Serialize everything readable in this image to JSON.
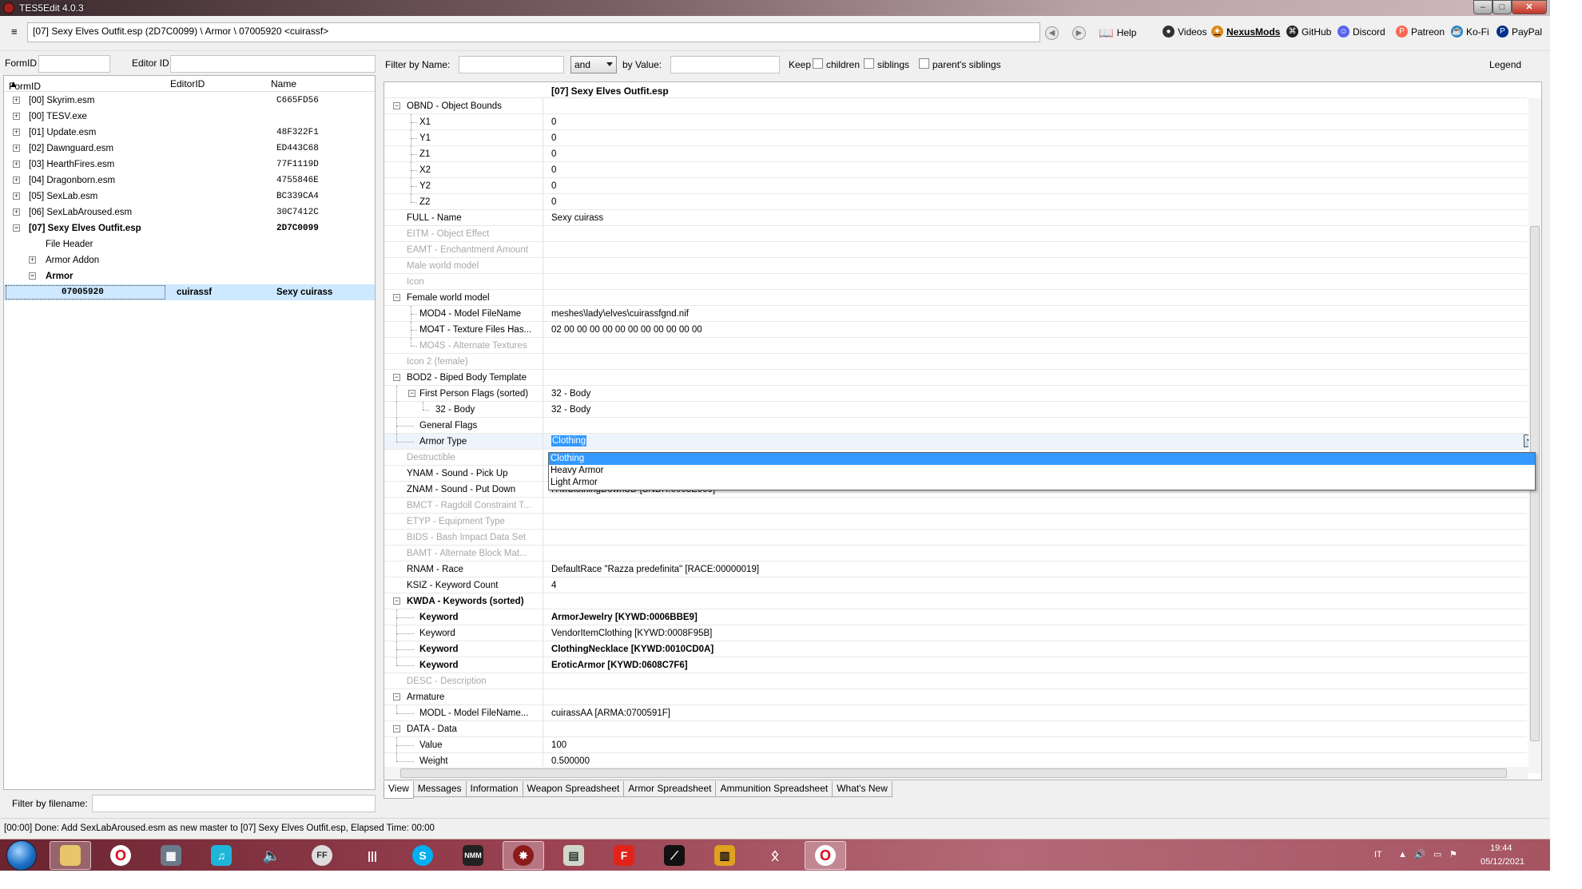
{
  "window": {
    "title": "TES5Edit 4.0.3"
  },
  "toolbar": {
    "path": "[07] Sexy Elves Outfit.esp (2D7C0099) \\ Armor \\ 07005920 <cuirassf>",
    "links": [
      "Help",
      "Videos",
      "NexusMods",
      "GitHub",
      "Discord",
      "Patreon",
      "Ko-Fi",
      "PayPal"
    ]
  },
  "left": {
    "formid_label": "FormID",
    "editorid_label": "Editor ID",
    "columns": [
      "FormID",
      "EditorID",
      "Name"
    ],
    "tree": [
      {
        "label": "[00] Skyrim.esm",
        "name": "C665FD56"
      },
      {
        "label": "[00] TESV.exe",
        "name": ""
      },
      {
        "label": "[01] Update.esm",
        "name": "48F322F1"
      },
      {
        "label": "[02] Dawnguard.esm",
        "name": "ED443C68"
      },
      {
        "label": "[03] HearthFires.esm",
        "name": "77F1119D"
      },
      {
        "label": "[04] Dragonborn.esm",
        "name": "4755846E"
      },
      {
        "label": "[05] SexLab.esm",
        "name": "BC339CA4"
      },
      {
        "label": "[06] SexLabAroused.esm",
        "name": "30C7412C"
      },
      {
        "label": "[07] Sexy Elves Outfit.esp",
        "name": "2D7C0099"
      },
      {
        "label": "File Header",
        "name": ""
      },
      {
        "label": "Armor Addon",
        "name": ""
      },
      {
        "label": "Armor",
        "name": ""
      },
      {
        "label": "07005920",
        "editorid": "cuirassf",
        "name": "Sexy cuirass"
      }
    ],
    "filter_label": "Filter by filename:"
  },
  "filter": {
    "by_name": "Filter by Name:",
    "and": "and",
    "by_value": "by Value:",
    "keep": "Keep",
    "children": "children",
    "siblings": "siblings",
    "parents_siblings": "parent's siblings",
    "legend": "Legend"
  },
  "grid": {
    "header": "[07] Sexy Elves Outfit.esp",
    "rows": [
      {
        "label": "OBND - Object Bounds",
        "value": ""
      },
      {
        "label": "X1",
        "value": "0"
      },
      {
        "label": "Y1",
        "value": "0"
      },
      {
        "label": "Z1",
        "value": "0"
      },
      {
        "label": "X2",
        "value": "0"
      },
      {
        "label": "Y2",
        "value": "0"
      },
      {
        "label": "Z2",
        "value": "0"
      },
      {
        "label": "FULL - Name",
        "value": "Sexy cuirass"
      },
      {
        "label": "EITM - Object Effect",
        "value": ""
      },
      {
        "label": "EAMT - Enchantment Amount",
        "value": ""
      },
      {
        "label": "Male world model",
        "value": ""
      },
      {
        "label": "Icon",
        "value": ""
      },
      {
        "label": "Female world model",
        "value": ""
      },
      {
        "label": "MOD4 - Model FileName",
        "value": "meshes\\lady\\elves\\cuirassfgnd.nif"
      },
      {
        "label": "MO4T - Texture Files Has...",
        "value": "02 00 00 00 00 00 00 00 00 00 00 00"
      },
      {
        "label": "MO4S - Alternate Textures",
        "value": ""
      },
      {
        "label": "Icon 2 (female)",
        "value": ""
      },
      {
        "label": "BOD2 - Biped Body Template",
        "value": ""
      },
      {
        "label": "First Person Flags (sorted)",
        "value": "32 - Body"
      },
      {
        "label": "32 - Body",
        "value": "32 - Body"
      },
      {
        "label": "General Flags",
        "value": ""
      },
      {
        "label": "Armor Type",
        "value": "Clothing"
      },
      {
        "label": "Destructible",
        "value": ""
      },
      {
        "label": "YNAM - Sound - Pick Up",
        "value": ""
      },
      {
        "label": "ZNAM - Sound - Put Down",
        "value": "ITMClothingDownSD [SNDR:0003E909]"
      },
      {
        "label": "BMCT - Ragdoll Constraint T...",
        "value": ""
      },
      {
        "label": "ETYP - Equipment Type",
        "value": ""
      },
      {
        "label": "BIDS - Bash Impact Data Set",
        "value": ""
      },
      {
        "label": "BAMT - Alternate Block Mat...",
        "value": ""
      },
      {
        "label": "RNAM - Race",
        "value": "DefaultRace \"Razza predefinita\" [RACE:00000019]"
      },
      {
        "label": "KSIZ - Keyword Count",
        "value": "4"
      },
      {
        "label": "KWDA - Keywords (sorted)",
        "value": ""
      },
      {
        "label": "Keyword",
        "value": "ArmorJewelry [KYWD:0006BBE9]"
      },
      {
        "label": "Keyword",
        "value": "VendorItemClothing [KYWD:0008F95B]"
      },
      {
        "label": "Keyword",
        "value": "ClothingNecklace [KYWD:0010CD0A]"
      },
      {
        "label": "Keyword",
        "value": "EroticArmor [KYWD:0608C7F6]"
      },
      {
        "label": "DESC - Description",
        "value": ""
      },
      {
        "label": "Armature",
        "value": ""
      },
      {
        "label": "MODL - Model FileName...",
        "value": "cuirassAA [ARMA:0700591F]"
      },
      {
        "label": "DATA - Data",
        "value": ""
      },
      {
        "label": "Value",
        "value": "100"
      },
      {
        "label": "Weight",
        "value": "0.500000"
      }
    ],
    "dropdown_options": [
      "Clothing",
      "Heavy Armor",
      "Light Armor"
    ]
  },
  "tabs": [
    "View",
    "Messages",
    "Information",
    "Weapon Spreadsheet",
    "Armor Spreadsheet",
    "Ammunition Spreadsheet",
    "What's New"
  ],
  "status": "[00:00] Done: Add SexLabAroused.esm as new master to [07] Sexy Elves Outfit.esp, Elapsed Time: 00:00",
  "taskbar": {
    "lang": "IT",
    "time": "19:44",
    "date": "05/12/2021"
  }
}
